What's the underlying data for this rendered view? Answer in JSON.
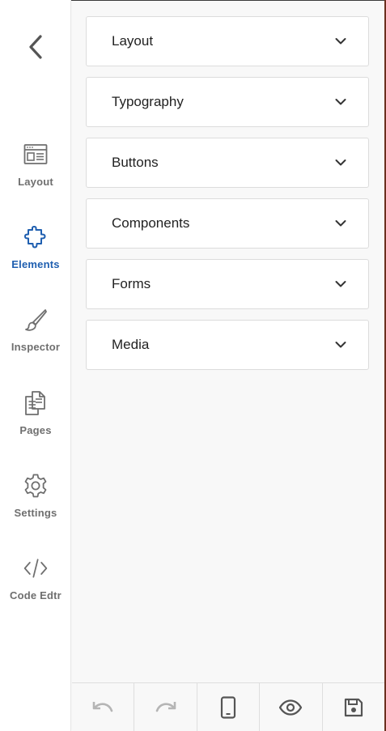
{
  "sidebar": {
    "back_icon": "chevron-left-icon",
    "items": [
      {
        "label": "Layout",
        "icon": "layout-icon",
        "active": false
      },
      {
        "label": "Elements",
        "icon": "puzzle-icon",
        "active": true
      },
      {
        "label": "Inspector",
        "icon": "brush-icon",
        "active": false
      },
      {
        "label": "Pages",
        "icon": "pages-icon",
        "active": false
      },
      {
        "label": "Settings",
        "icon": "gear-icon",
        "active": false
      },
      {
        "label": "Code Edtr",
        "icon": "code-icon",
        "active": false
      }
    ]
  },
  "main": {
    "panels": [
      {
        "label": "Layout"
      },
      {
        "label": "Typography"
      },
      {
        "label": "Buttons"
      },
      {
        "label": "Components"
      },
      {
        "label": "Forms"
      },
      {
        "label": "Media"
      }
    ]
  },
  "toolbar": {
    "buttons": [
      {
        "icon": "undo-icon",
        "enabled": false
      },
      {
        "icon": "redo-icon",
        "enabled": false
      },
      {
        "icon": "mobile-icon",
        "enabled": true
      },
      {
        "icon": "eye-icon",
        "enabled": true
      },
      {
        "icon": "save-icon",
        "enabled": true
      }
    ]
  },
  "colors": {
    "accent": "#1f5fb0",
    "icon_gray": "#6f6f6f",
    "disabled_gray": "#b5b5b5"
  }
}
